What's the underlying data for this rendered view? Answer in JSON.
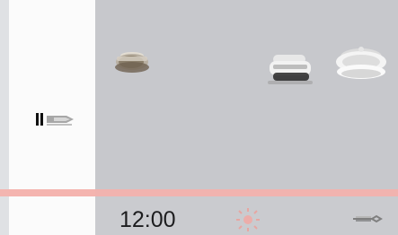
{
  "status": {
    "time": "12:00"
  },
  "sidebar": {
    "items": [
      {
        "icon": "input-arrow-icon"
      }
    ]
  },
  "main": {
    "programs": [
      {
        "icon": "pot-icon"
      },
      {
        "icon": "rice-cooker-icon"
      },
      {
        "icon": "plate-icon"
      }
    ]
  },
  "footer": {
    "icons": [
      {
        "icon": "sun-icon"
      },
      {
        "icon": "wrench-icon"
      }
    ]
  },
  "colors": {
    "accent": "#f3b2ad",
    "panel": "#c7c8cc",
    "text": "#1d1d1f"
  }
}
